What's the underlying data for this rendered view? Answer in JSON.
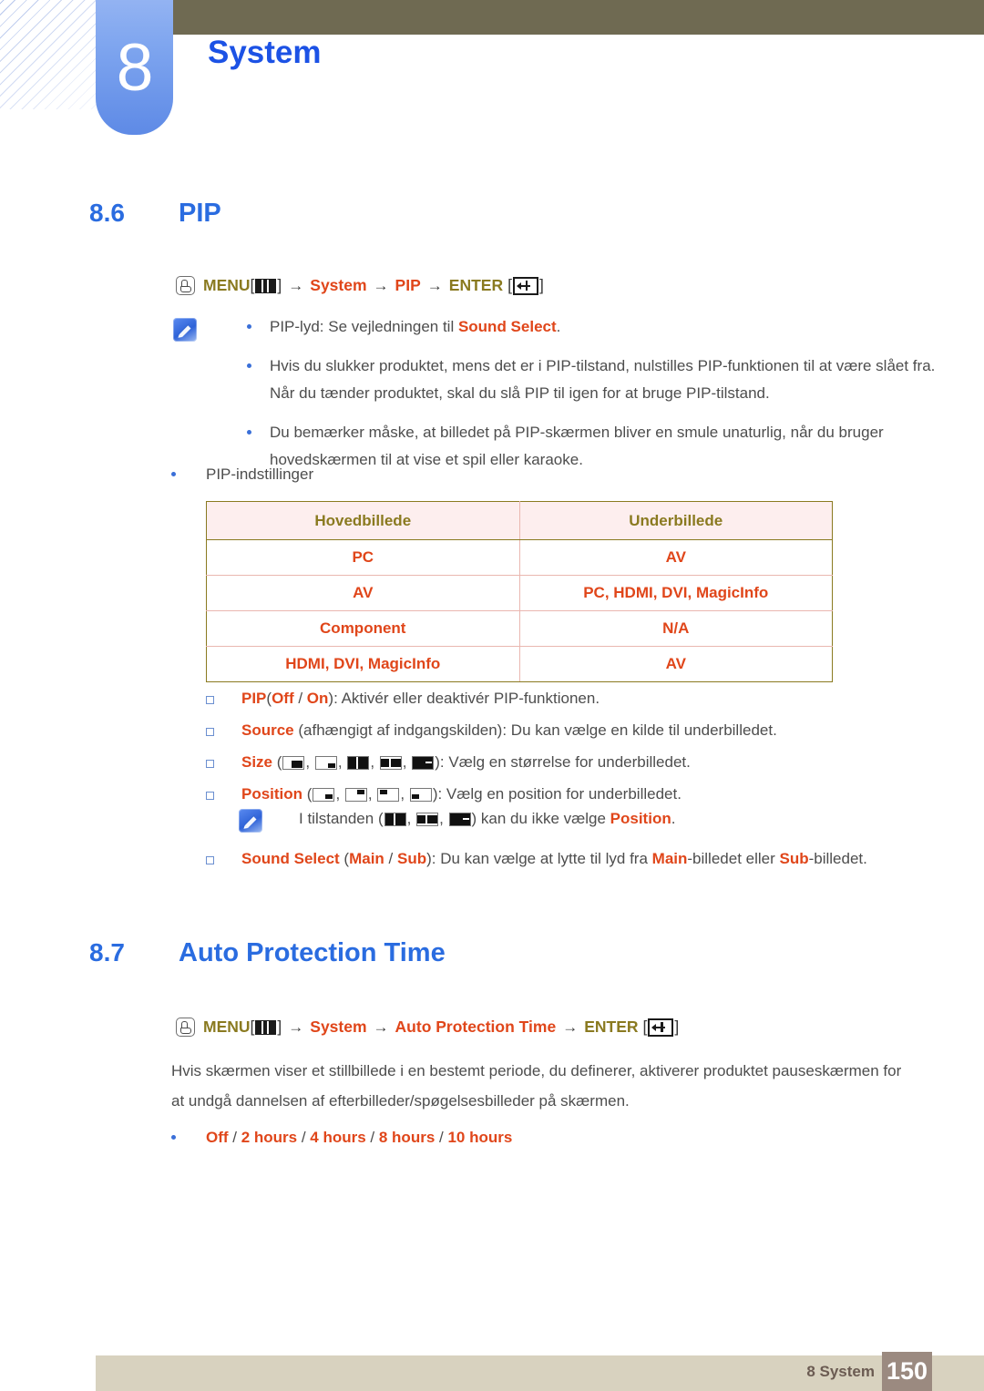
{
  "header": {
    "chapter_number": "8",
    "chapter_title": "System"
  },
  "sections": [
    {
      "number": "8.6",
      "title": "PIP",
      "menu_path": {
        "menu_label": "MENU",
        "menu_icon": "menu-keypad-icon",
        "arrow": "→",
        "step1": "System",
        "step2": "PIP",
        "enter_label": "ENTER",
        "enter_icon": "enter-key-icon",
        "bracket_open": "[",
        "bracket_close": "]"
      }
    },
    {
      "number": "8.7",
      "title": "Auto Protection Time",
      "menu_path": {
        "menu_label": "MENU",
        "menu_icon": "menu-keypad-icon",
        "arrow": "→",
        "step1": "System",
        "step2": "Auto Protection Time",
        "enter_label": "ENTER",
        "enter_icon": "enter-key-icon",
        "bracket_open": "[",
        "bracket_close": "]"
      }
    }
  ],
  "note_one": {
    "items": [
      {
        "pre": "PIP-lyd: Se vejledningen til ",
        "em": "Sound Select",
        "post": "."
      },
      {
        "pre": "Hvis du slukker produktet, mens det er i PIP-tilstand, nulstilles PIP-funktionen til at være slået fra. Når du tænder produktet, skal du slå PIP til igen for at bruge PIP-tilstand.",
        "em": "",
        "post": ""
      },
      {
        "pre": "Du bemærker måske, at billedet på PIP-skærmen bliver en smule unaturlig, når du bruger hovedskærmen til at vise et spil eller karaoke.",
        "em": "",
        "post": ""
      }
    ]
  },
  "pip_settings_label": "PIP-indstillinger",
  "table": {
    "headers": [
      "Hovedbillede",
      "Underbillede"
    ],
    "rows": [
      [
        "PC",
        "AV"
      ],
      [
        "AV",
        "PC, HDMI, DVI, MagicInfo"
      ],
      [
        "Component",
        "N/A"
      ],
      [
        "HDMI, DVI, MagicInfo",
        "AV"
      ]
    ]
  },
  "options": {
    "pip": {
      "name": "PIP",
      "paren_open": "(",
      "v1": "Off",
      "sep": " / ",
      "v2": "On",
      "paren_close": ")",
      "desc": ": Aktivér eller deaktivér PIP-funktionen."
    },
    "source": {
      "name": "Source",
      "qualifier": " (afhængigt af indgangskilden)",
      "desc": ": Du kan vælge en kilde til underbilledet."
    },
    "size": {
      "name": "Size",
      "paren_open": " (",
      "paren_close": ")",
      "comma": ", ",
      "desc": ": Vælg en størrelse for underbilledet.",
      "icons": [
        "size-large-bottom-right-icon",
        "size-small-bottom-right-icon",
        "size-double-wide-icon",
        "size-double-window-icon",
        "size-wide-bar-icon"
      ]
    },
    "position": {
      "name": "Position",
      "paren_open": " (",
      "paren_close": ")",
      "comma": ", ",
      "desc": ": Vælg en position for underbilledet.",
      "icons": [
        "position-bottom-right-icon",
        "position-top-right-icon",
        "position-top-left-icon",
        "position-bottom-left-icon"
      ]
    },
    "sound_select": {
      "name": "Sound Select",
      "paren_open": " (",
      "v1": "Main",
      "sep": " / ",
      "v2": "Sub",
      "paren_close": ")",
      "desc_a": ": Du kan vælge at lytte til lyd fra ",
      "em1": "Main",
      "desc_b": "-billedet eller ",
      "em2": "Sub",
      "desc_c": "-billedet."
    }
  },
  "note_two": {
    "pre": "I tilstanden (",
    "comma": ", ",
    "mid": ") kan du ikke vælge ",
    "em": "Position",
    "post": ".",
    "icons": [
      "size-double-wide-icon",
      "size-double-window-icon",
      "size-wide-bar-icon"
    ]
  },
  "auto_protection": {
    "paragraph": "Hvis skærmen viser et stillbillede i en bestemt periode, du definerer, aktiverer produktet pauseskærmen for at undgå dannelsen af efterbilleder/spøgelsesbilleder på skærmen.",
    "option_line": {
      "v1": "Off",
      "sep": " / ",
      "v2": "2 hours",
      "v3": "4 hours",
      "v4": "8 hours",
      "v5": "10 hours"
    }
  },
  "footer": {
    "label": "8 System",
    "page": "150"
  },
  "colors": {
    "accent_blue": "#2a6ce0",
    "title_blue": "#1c52e5",
    "accent_red": "#e0461a",
    "olive": "#8a7a20",
    "header_bar": "#6f6a52",
    "footer_bar": "#d8d2bf",
    "footer_page_box": "#9b8a80"
  }
}
